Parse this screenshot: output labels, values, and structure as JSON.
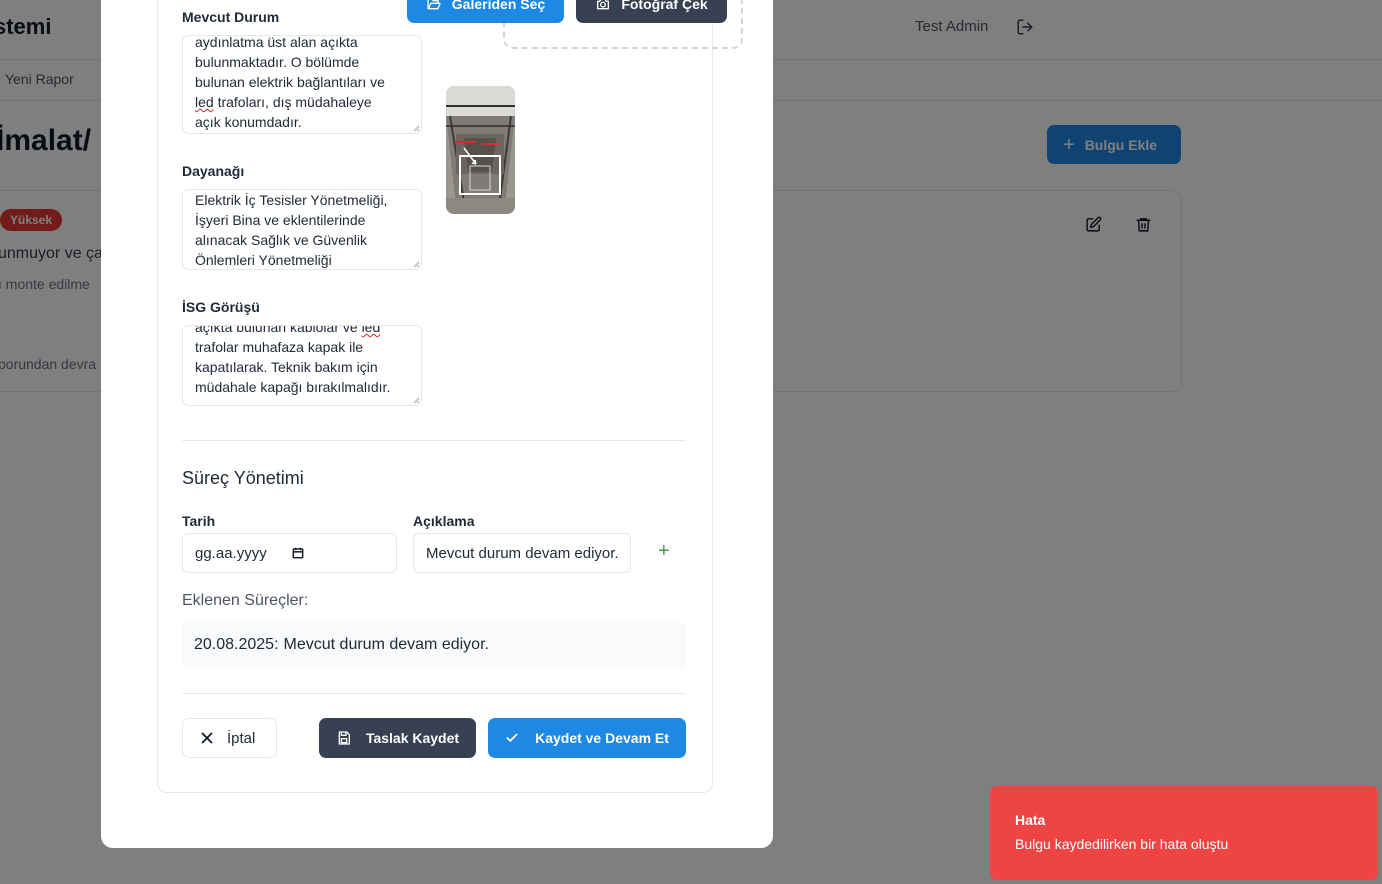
{
  "app": {
    "title_partial": "stemi",
    "user_name": "Test Admin"
  },
  "breadcrumb": {
    "label": "Yeni Rapor"
  },
  "page": {
    "heading_partial": "İmalat/",
    "add_finding_label": "Bulgu Ekle"
  },
  "finding": {
    "severity": "Yüksek",
    "text_line1": "unmuyor ve ça",
    "text_line2": "ı monte edilme",
    "text_line3": "porundan devra"
  },
  "form": {
    "current_state": {
      "label": "Mevcut Durum",
      "lines": [
        "aydınlatma üst alan açıkta",
        "bulunmaktadır. O bölümde",
        "bulunan elektrik bağlantıları ve"
      ],
      "line4_led": "led",
      "line4_rest": " trafoları, dış müdahaleye",
      "line5": "açık konumdadır."
    },
    "basis": {
      "label": "Dayanağı",
      "lines": [
        "Elektrik İç Tesisler Yönetmeliği,",
        "İşyeri Bina ve eklentilerinde",
        "alınacak Sağlık ve Güvenlik",
        "Önlemleri Yönetmeliği"
      ]
    },
    "ohs_opinion": {
      "label": "İSG Görüşü",
      "line1_start": "açıkta bulunan kablolar ve ",
      "line1_led": "led",
      "lines": [
        "trafolar muhafaza kapak ile",
        "kapatılarak. Teknik bakım için",
        "müdahale kapağı bırakılmalıdır."
      ]
    },
    "photo": {
      "gallery_label": "Galeriden Seç",
      "camera_label": "Fotoğraf Çek"
    }
  },
  "process": {
    "title": "Süreç Yönetimi",
    "date_label": "Tarih",
    "date_placeholder": "gg.aa.yyyy",
    "desc_label": "Açıklama",
    "desc_value": "Mevcut durum devam ediyor.",
    "add_icon": "+",
    "added_label": "Eklenen Süreçler:",
    "items": [
      {
        "date": "20.08.2025:",
        "text": "Mevcut durum devam ediyor."
      }
    ]
  },
  "actions": {
    "cancel": "İptal",
    "draft": "Taslak Kaydet",
    "save": "Kaydet ve Devam Et"
  },
  "toast": {
    "title": "Hata",
    "message": "Bulgu kaydedilirken bir hata oluştu"
  },
  "colors": {
    "primary": "#1e88e5",
    "dark": "#374151",
    "danger": "#ef4444",
    "badge": "#e53935",
    "success": "#43a047"
  },
  "icons": [
    "logout-icon",
    "plus-icon",
    "edit-icon",
    "trash-icon",
    "folder-open-icon",
    "camera-icon",
    "calendar-icon",
    "x-icon",
    "save-icon",
    "check-icon"
  ]
}
